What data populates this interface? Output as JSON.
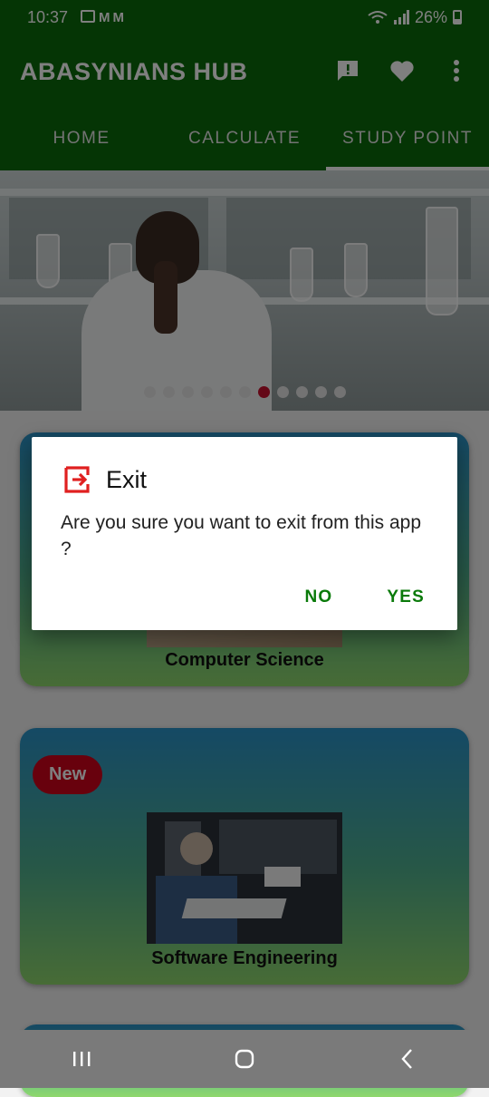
{
  "status_bar": {
    "time": "10:37",
    "battery": "26%",
    "notification_icons": [
      "image-icon",
      "gmail-icon",
      "gmail-icon"
    ],
    "signal_icons": [
      "wifi-icon",
      "signal-icon"
    ]
  },
  "app_bar": {
    "title": "ABASYNIANS HUB",
    "actions": [
      "feedback-icon",
      "heart-icon",
      "more-vert-icon"
    ],
    "tabs": [
      {
        "label": "HOME"
      },
      {
        "label": "CALCULATE"
      },
      {
        "label": "STUDY POINT"
      }
    ],
    "active_tab": 2
  },
  "carousel": {
    "slide_count": 11,
    "active_index": 6
  },
  "cards": [
    {
      "label": "Computer Science"
    },
    {
      "label": "Software Engineering",
      "badge": "New"
    }
  ],
  "dialog": {
    "title": "Exit",
    "message": "Are you sure you want to exit from this app ?",
    "no_label": "NO",
    "yes_label": "YES"
  },
  "colors": {
    "primary": "#0a6b0a",
    "accent_red": "#d0021b",
    "dialog_button": "#0a7a0a"
  }
}
